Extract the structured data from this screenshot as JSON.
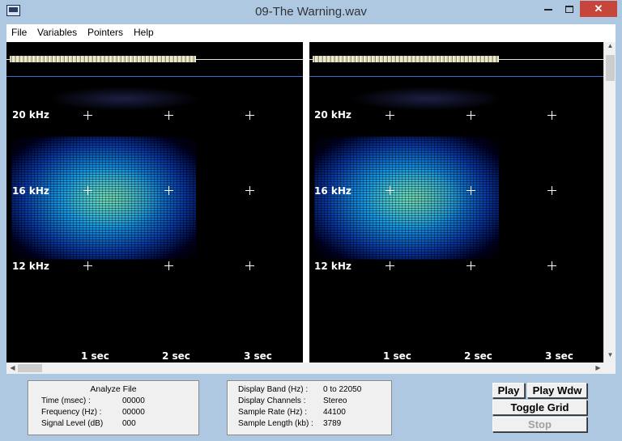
{
  "window": {
    "title": "09-The Warning.wav",
    "close_glyph": "✕"
  },
  "menu": [
    "File",
    "Variables",
    "Pointers",
    "Help"
  ],
  "spectrogram": {
    "freq_labels": [
      "20 kHz",
      "16 kHz",
      "12 kHz"
    ],
    "time_labels": [
      "1  sec",
      "2  sec",
      "3  sec"
    ],
    "colors": {
      "background": "#000000",
      "marker_line": "#3a6fd0",
      "spectrum_core": "#48d6ea",
      "spectrum_edge": "#143d9a"
    }
  },
  "analyze_file": {
    "heading": "Analyze File",
    "rows": [
      {
        "label": "Time (msec) :",
        "value": "00000"
      },
      {
        "label": "Frequency (Hz) :",
        "value": "00000"
      },
      {
        "label": "Signal Level (dB)",
        "value": "000"
      }
    ]
  },
  "display_info": {
    "rows": [
      {
        "label": "Display Band (Hz) :",
        "value": "0 to 22050"
      },
      {
        "label": "Display Channels :",
        "value": "Stereo"
      },
      {
        "label": "Sample Rate (Hz) :",
        "value": "44100"
      },
      {
        "label": "Sample Length (kb) :",
        "value": "3789"
      }
    ]
  },
  "buttons": {
    "play": "Play",
    "play_wdw": "Play Wdw",
    "toggle_grid": "Toggle Grid",
    "stop": "Stop"
  }
}
